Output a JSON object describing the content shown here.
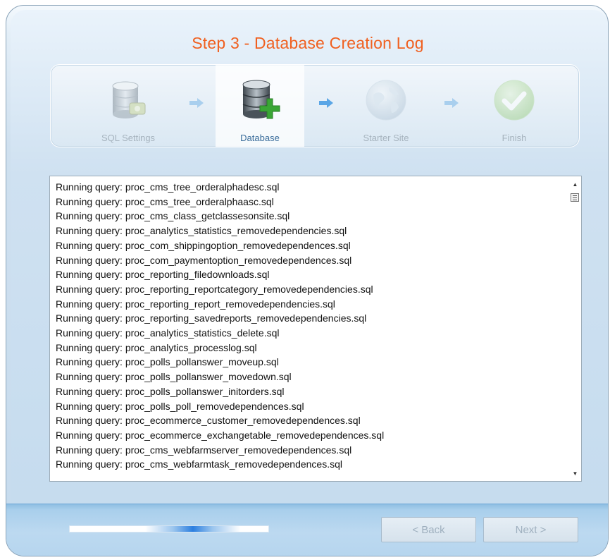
{
  "title": "Step 3 - Database Creation Log",
  "steps": [
    {
      "label": "SQL Settings",
      "icon": "sql-settings-icon",
      "state": "done"
    },
    {
      "label": "Database",
      "icon": "database-add-icon",
      "state": "active"
    },
    {
      "label": "Starter Site",
      "icon": "globe-icon",
      "state": "pending"
    },
    {
      "label": "Finish",
      "icon": "checkmark-icon",
      "state": "pending"
    }
  ],
  "log_lines": [
    "Running query: proc_cms_tree_orderalphadesc.sql",
    "Running query: proc_cms_tree_orderalphaasc.sql",
    "Running query: proc_cms_class_getclassesonsite.sql",
    "Running query: proc_analytics_statistics_removedependencies.sql",
    "Running query: proc_com_shippingoption_removedependences.sql",
    "Running query: proc_com_paymentoption_removedependences.sql",
    "Running query: proc_reporting_filedownloads.sql",
    "Running query: proc_reporting_reportcategory_removedependencies.sql",
    "Running query: proc_reporting_report_removedependencies.sql",
    "Running query: proc_reporting_savedreports_removedependencies.sql",
    "Running query: proc_analytics_statistics_delete.sql",
    "Running query: proc_analytics_processlog.sql",
    "Running query: proc_polls_pollanswer_moveup.sql",
    "Running query: proc_polls_pollanswer_movedown.sql",
    "Running query: proc_polls_pollanswer_initorders.sql",
    "Running query: proc_polls_poll_removedependences.sql",
    "Running query: proc_ecommerce_customer_removedependences.sql",
    "Running query: proc_ecommerce_exchangetable_removedependences.sql",
    "Running query: proc_cms_webfarmserver_removedependences.sql",
    "Running query: proc_cms_webfarmtask_removedependences.sql"
  ],
  "buttons": {
    "back": "< Back",
    "next": "Next >"
  },
  "colors": {
    "title": "#f06020",
    "active_step": "#3c6e9c",
    "inactive_step": "#a6b3be"
  }
}
